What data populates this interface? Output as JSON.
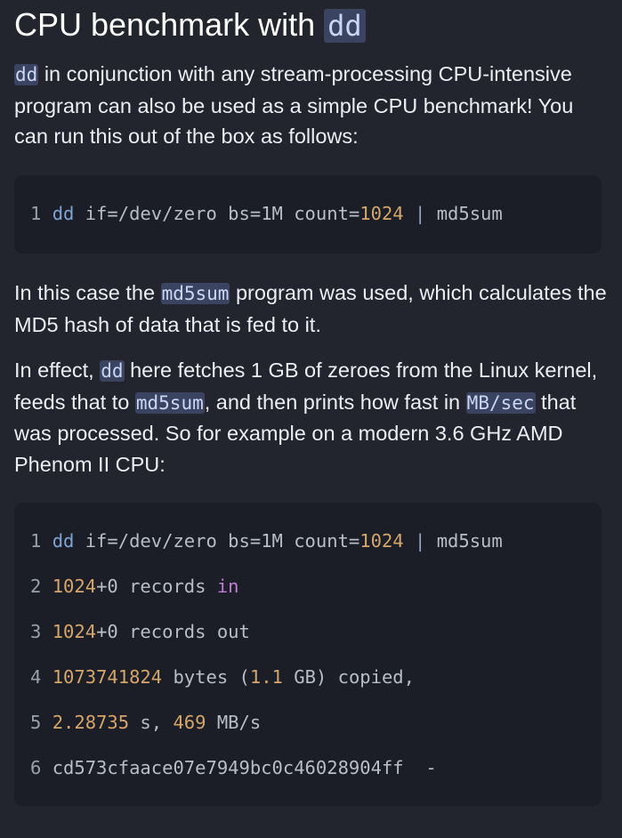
{
  "heading": {
    "text": "CPU benchmark with ",
    "code": "dd"
  },
  "para1": {
    "code": "dd",
    "text": " in conjunction with any stream-processing CPU-intensive program can also be used as a simple CPU benchmark! You can run this out of the box as follows:"
  },
  "code_block_1": {
    "lines": [
      {
        "num": "1",
        "parts": [
          "dd",
          " if=/dev/zero bs=1M count=",
          "1024",
          " | ",
          "md5sum"
        ]
      }
    ]
  },
  "para2": {
    "before": "In this case the ",
    "code": "md5sum",
    "after": " program was used, which calculates the MD5 hash of data that is fed to it."
  },
  "para3": {
    "t1": "In effect, ",
    "c1": "dd",
    "t2": " here fetches 1 GB of zeroes from the Linux kernel, feeds that to ",
    "c2": "md5sum",
    "t3": ", and then prints how fast in ",
    "c3": "MB/sec",
    "t4": " that was processed. So for example on a modern 3.6 GHz AMD Phenom II CPU:"
  },
  "code_block_2": {
    "lines": [
      {
        "num": "1",
        "parts": [
          "dd",
          " if=/dev/zero bs=1M count=",
          "1024",
          " | ",
          "md5sum"
        ]
      },
      {
        "num": "2",
        "parts": [
          "1024",
          "+0 records ",
          "in"
        ]
      },
      {
        "num": "3",
        "parts": [
          "1024",
          "+0 records out"
        ]
      },
      {
        "num": "4",
        "parts": [
          "1073741824",
          " bytes (",
          "1.1",
          " GB) copied,"
        ]
      },
      {
        "num": "5",
        "parts": [
          "2.28735",
          " s, ",
          "469",
          " MB/s"
        ]
      },
      {
        "num": "6",
        "parts": [
          "cd573cfaace07e7949bc0c46028904ff  -"
        ]
      }
    ]
  },
  "colors": {
    "background": "#22252e",
    "code_block_bg": "#1b1e26",
    "inline_code_bg": "#3a4460",
    "keyword": "#7ea5d8",
    "number": "#d6a56a",
    "keyword_in": "#c37cd6"
  }
}
